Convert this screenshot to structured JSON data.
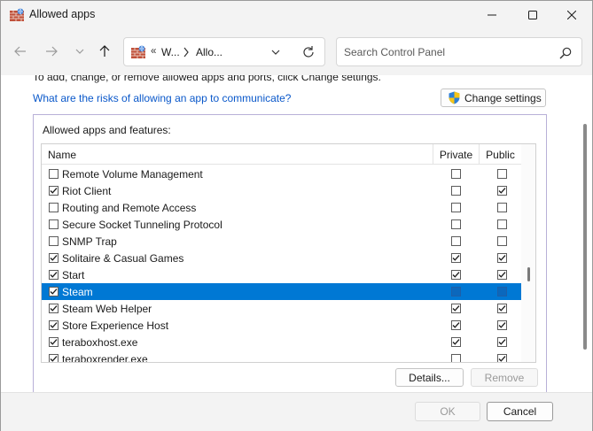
{
  "window": {
    "title": "Allowed apps",
    "icon": "firewall-icon"
  },
  "navigation": {
    "address_chevron": "«",
    "address_part1": "W...",
    "address_part2": "Allo...",
    "search_placeholder": "Search Control Panel"
  },
  "content": {
    "intro_text": "To add, change, or remove allowed apps and ports, click Change settings.",
    "risk_link": "What are the risks of allowing an app to communicate?",
    "change_settings": "Change settings"
  },
  "group": {
    "label": "Allowed apps and features:",
    "columns": {
      "name": "Name",
      "private": "Private",
      "public": "Public"
    },
    "apps": [
      {
        "name": "Remote Volume Management",
        "enabled": false,
        "private": false,
        "public": false,
        "selected": false
      },
      {
        "name": "Riot Client",
        "enabled": true,
        "private": false,
        "public": true,
        "selected": false
      },
      {
        "name": "Routing and Remote Access",
        "enabled": false,
        "private": false,
        "public": false,
        "selected": false
      },
      {
        "name": "Secure Socket Tunneling Protocol",
        "enabled": false,
        "private": false,
        "public": false,
        "selected": false
      },
      {
        "name": "SNMP Trap",
        "enabled": false,
        "private": false,
        "public": false,
        "selected": false
      },
      {
        "name": "Solitaire & Casual Games",
        "enabled": true,
        "private": true,
        "public": true,
        "selected": false
      },
      {
        "name": "Start",
        "enabled": true,
        "private": true,
        "public": true,
        "selected": false
      },
      {
        "name": "Steam",
        "enabled": true,
        "private": false,
        "public": false,
        "selected": true
      },
      {
        "name": "Steam Web Helper",
        "enabled": true,
        "private": true,
        "public": true,
        "selected": false
      },
      {
        "name": "Store Experience Host",
        "enabled": true,
        "private": true,
        "public": true,
        "selected": false
      },
      {
        "name": "teraboxhost.exe",
        "enabled": true,
        "private": true,
        "public": true,
        "selected": false
      },
      {
        "name": "teraboxrender.exe",
        "enabled": true,
        "private": false,
        "public": true,
        "selected": false
      }
    ],
    "details_button": "Details...",
    "remove_button": "Remove"
  },
  "footer": {
    "ok_button": "OK",
    "cancel_button": "Cancel"
  },
  "colors": {
    "accent": "#0078d4",
    "link": "#0a58ca",
    "chrome": "#f3f3f3"
  }
}
